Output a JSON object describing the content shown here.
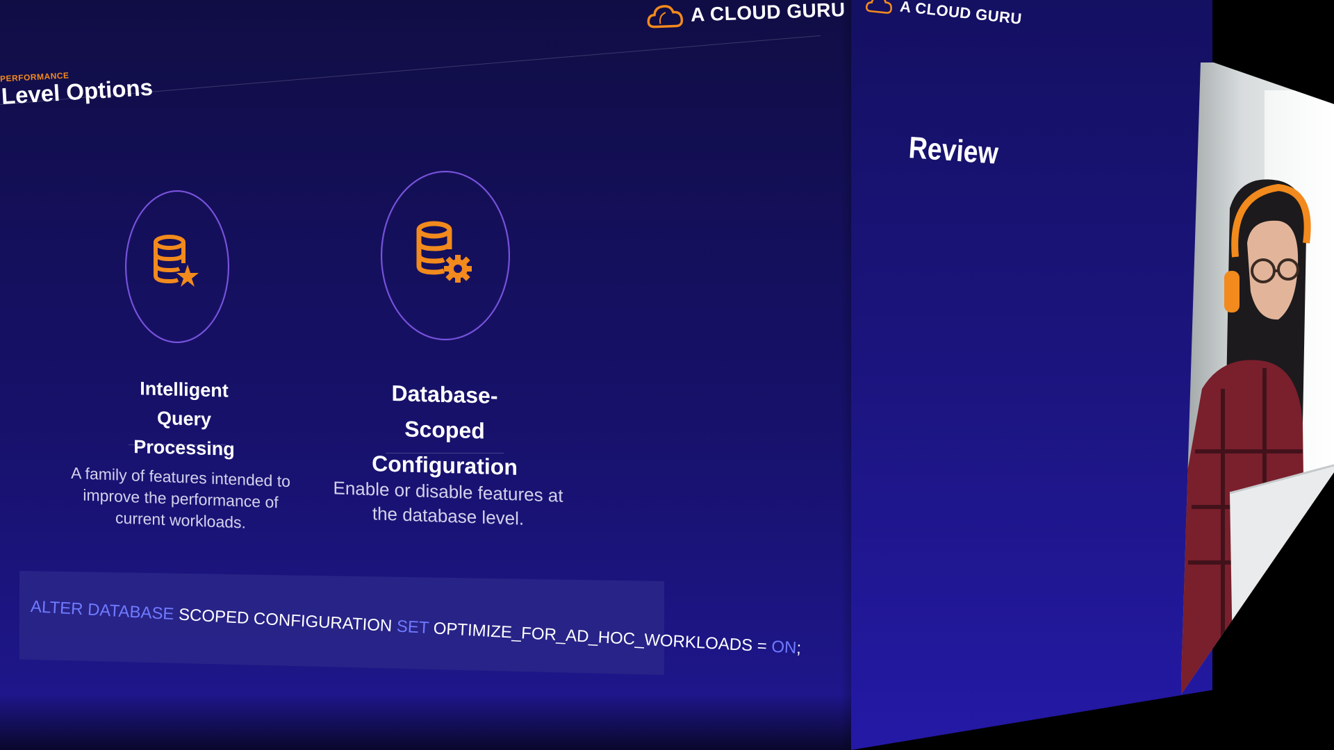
{
  "brand": {
    "name": "A CLOUD GURU",
    "accent": "#f28a1d"
  },
  "slide_left": {
    "eyebrow": "PERFORMANCE",
    "title": "Level Options",
    "features": [
      {
        "title": "Intelligent Query Processing",
        "description": "A family of features intended to improve the performance of current workloads.",
        "icon": "database-star-icon"
      },
      {
        "title": "Database-Scoped Configuration",
        "description": "Enable or disable features at the database level.",
        "icon": "database-gear-icon"
      }
    ],
    "code": {
      "kw1": "ALTER DATABASE",
      "t1": " SCOPED CONFIGURATION ",
      "kw2": "SET",
      "t2": " OPTIMIZE_FOR_AD_HOC_WORKLOADS = ",
      "kw3": "ON",
      "t3": ";"
    }
  },
  "slide_right": {
    "title": "Review"
  },
  "colors": {
    "slide_bg": "#17116a",
    "circle_outline": "#7b55e0",
    "keyword_blue": "#6f7bff",
    "icon_orange": "#f28a1d"
  }
}
